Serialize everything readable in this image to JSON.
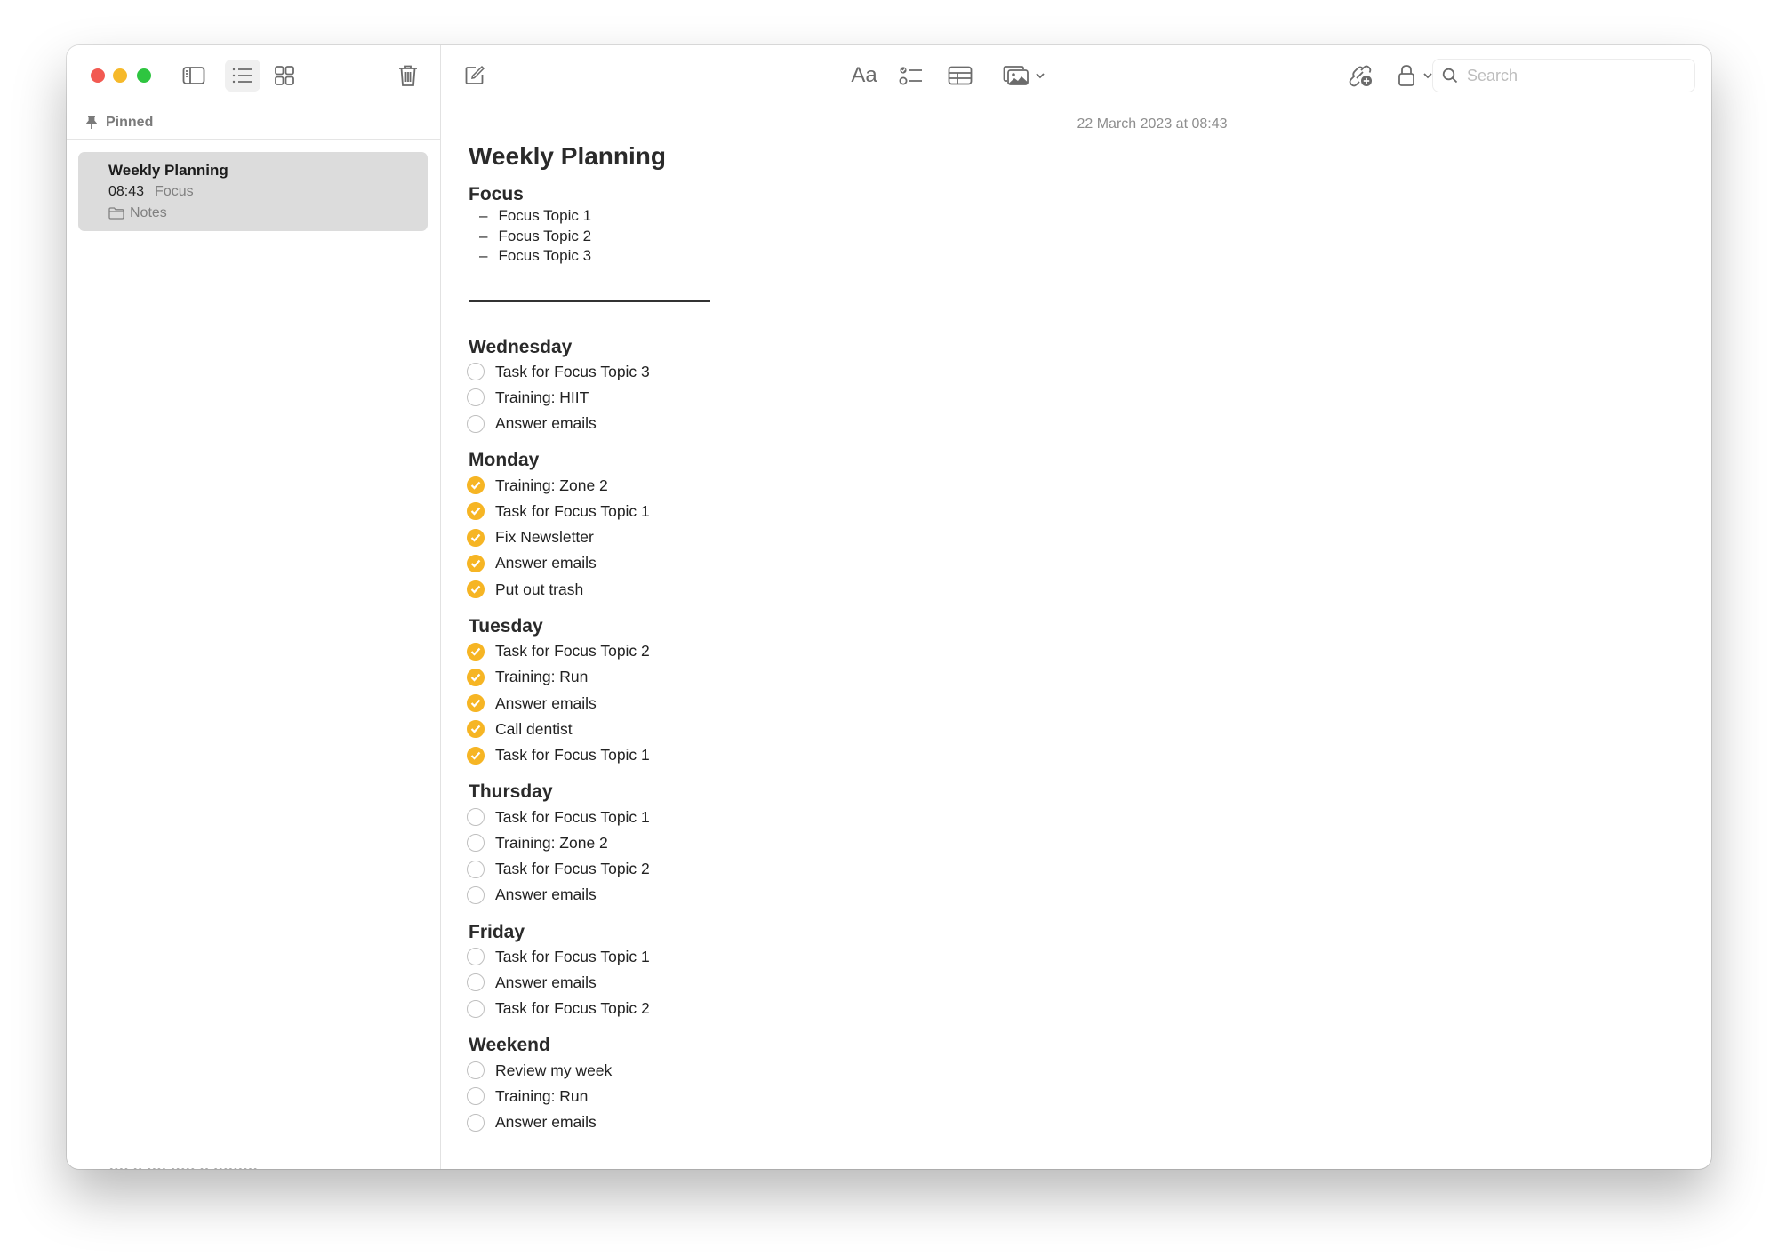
{
  "sidebar": {
    "pinned_label": "Pinned",
    "notes": [
      {
        "title": "Weekly Planning",
        "time": "08:43",
        "preview": "Focus",
        "folder": "Notes"
      }
    ],
    "cutoff_text": "•••• •• •••• ••••• •• •••••••••"
  },
  "toolbar": {
    "format_label": "Aa",
    "search_placeholder": "Search",
    "search_value": ""
  },
  "note": {
    "date": "22 March 2023 at 08:43",
    "title": "Weekly Planning",
    "focus_heading": "Focus",
    "focus_items": [
      "Focus Topic 1",
      "Focus Topic 2",
      "Focus Topic 3"
    ],
    "sections": [
      {
        "heading": "Wednesday",
        "tasks": [
          {
            "text": "Task for Focus Topic 3",
            "done": false
          },
          {
            "text": "Training: HIIT",
            "done": false
          },
          {
            "text": "Answer emails",
            "done": false
          }
        ]
      },
      {
        "heading": "Monday",
        "tasks": [
          {
            "text": "Training: Zone 2",
            "done": true
          },
          {
            "text": "Task for Focus Topic 1",
            "done": true
          },
          {
            "text": "Fix Newsletter",
            "done": true
          },
          {
            "text": "Answer emails",
            "done": true
          },
          {
            "text": "Put out trash",
            "done": true
          }
        ]
      },
      {
        "heading": "Tuesday",
        "tasks": [
          {
            "text": "Task for Focus Topic 2",
            "done": true
          },
          {
            "text": "Training: Run",
            "done": true
          },
          {
            "text": "Answer emails",
            "done": true
          },
          {
            "text": "Call dentist",
            "done": true
          },
          {
            "text": "Task for Focus Topic 1",
            "done": true
          }
        ]
      },
      {
        "heading": "Thursday",
        "tasks": [
          {
            "text": "Task for Focus Topic 1",
            "done": false
          },
          {
            "text": "Training: Zone 2",
            "done": false
          },
          {
            "text": "Task for Focus Topic 2",
            "done": false
          },
          {
            "text": "Answer emails",
            "done": false
          }
        ]
      },
      {
        "heading": "Friday",
        "tasks": [
          {
            "text": "Task for Focus Topic 1",
            "done": false
          },
          {
            "text": "Answer emails",
            "done": false
          },
          {
            "text": "Task for Focus Topic 2",
            "done": false
          }
        ]
      },
      {
        "heading": "Weekend",
        "tasks": [
          {
            "text": "Review my week",
            "done": false
          },
          {
            "text": "Training: Run",
            "done": false
          },
          {
            "text": "Answer emails",
            "done": false
          }
        ]
      }
    ]
  },
  "colors": {
    "checked": "#f6b524",
    "close": "#f25a52",
    "minimize": "#f6b92a",
    "maximize": "#2ec540"
  }
}
